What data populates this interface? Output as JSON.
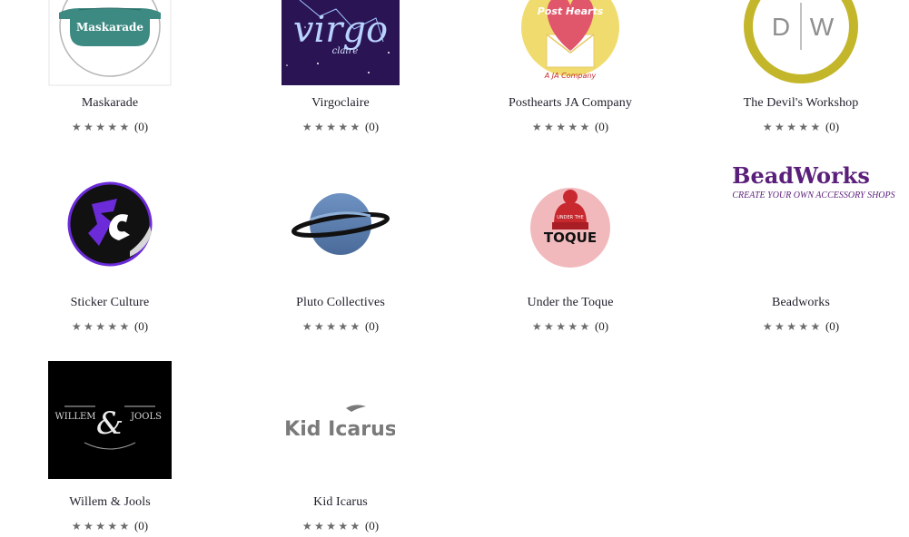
{
  "shops": [
    {
      "name": "Maskarade",
      "logo_text": "Maskarade",
      "rating": "★★★★★",
      "count": "(0)"
    },
    {
      "name": "Virgoclaire",
      "logo_text": "virgo",
      "logo_subtext": "claire",
      "rating": "★★★★★",
      "count": "(0)"
    },
    {
      "name": "Posthearts JA Company",
      "logo_text": "Post Hearts",
      "logo_subtext": "A JA Company",
      "rating": "★★★★★",
      "count": "(0)"
    },
    {
      "name": "The Devil's Workshop",
      "logo_text_left": "D",
      "logo_text_right": "W",
      "rating": "★★★★★",
      "count": "(0)"
    },
    {
      "name": "Sticker Culture",
      "logo_text": "SC",
      "rating": "★★★★★",
      "count": "(0)"
    },
    {
      "name": "Pluto Collectives",
      "rating": "★★★★★",
      "count": "(0)"
    },
    {
      "name": "Under the Toque",
      "logo_text": "TOQUE",
      "logo_subtext": "UNDER THE",
      "rating": "★★★★★",
      "count": "(0)"
    },
    {
      "name": "Beadworks",
      "logo_text": "BeadWorks",
      "logo_subtext": "CREATE YOUR OWN ACCESSORY SHOPS",
      "rating": "★★★★★",
      "count": "(0)"
    },
    {
      "name": "Willem & Jools",
      "logo_text_left": "WILLEM",
      "logo_text_right": "JOOLS",
      "logo_amp": "&",
      "rating": "★★★★★",
      "count": "(0)"
    },
    {
      "name": "Kid Icarus",
      "logo_text": "Kid Icarus",
      "rating": "★★★★★",
      "count": "(0)"
    }
  ],
  "colors": {
    "maskarade_teal": "#3d8a83",
    "virgo_purple": "#2b1454",
    "posthearts_yellow": "#f0dc6e",
    "posthearts_red": "#e0566b",
    "devil_olive": "#c3b62a",
    "sticker_purple": "#6b2bd9",
    "pluto_blue": "#5b7fb0",
    "toque_pink": "#f2b9bd",
    "toque_red": "#c7292f",
    "beadworks_purple": "#5a1f7a",
    "willem_black": "#000000",
    "kid_gray": "#7a7a7a"
  }
}
